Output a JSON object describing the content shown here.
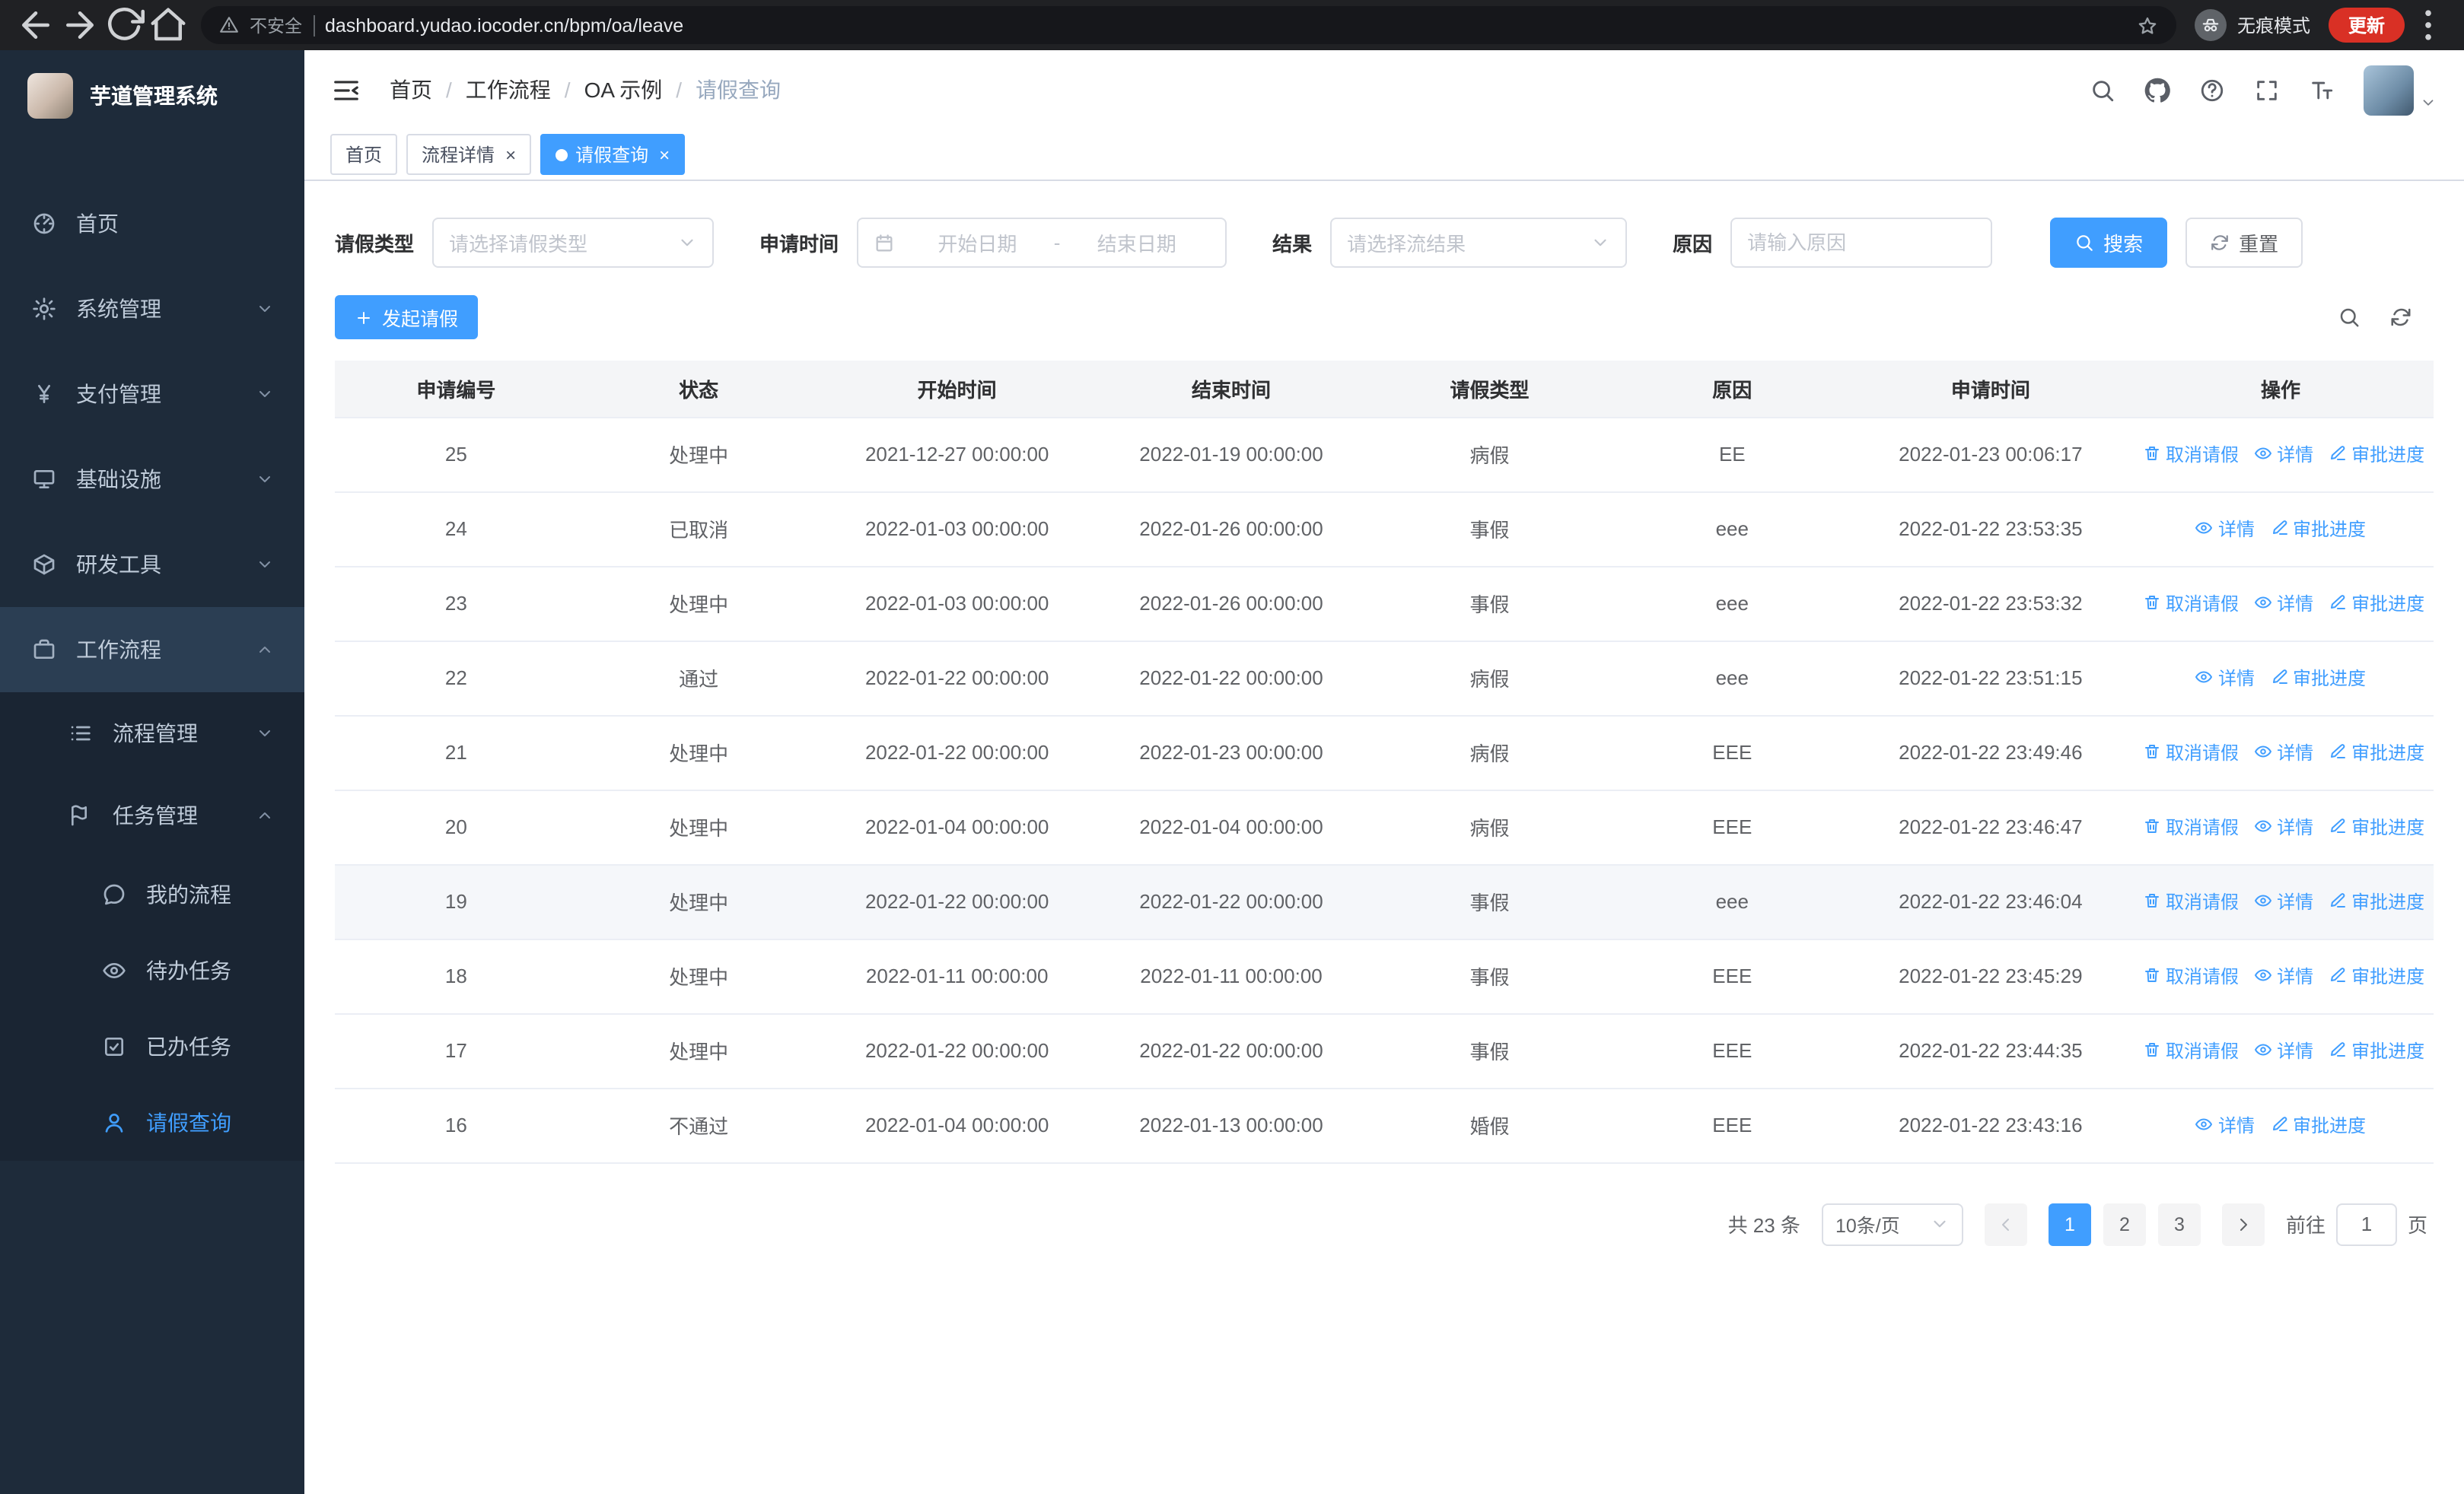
{
  "browser": {
    "security_label": "不安全",
    "url": "dashboard.yudao.iocoder.cn/bpm/oa/leave",
    "incognito_label": "无痕模式",
    "update_label": "更新"
  },
  "colors": {
    "primary": "#409eff",
    "update_button": "#d93025",
    "sidebar_bg": "#1e2b3a"
  },
  "sidebar": {
    "logo_title": "芋道管理系统",
    "items": [
      {
        "name": "home",
        "label": "首页",
        "icon": "dashboard-icon",
        "level": 1
      },
      {
        "name": "system",
        "label": "系统管理",
        "icon": "gear-icon",
        "level": 1,
        "chevron": "down"
      },
      {
        "name": "payment",
        "label": "支付管理",
        "icon": "yen-icon",
        "level": 1,
        "chevron": "down"
      },
      {
        "name": "infrastructure",
        "label": "基础设施",
        "icon": "monitor-icon",
        "level": 1,
        "chevron": "down"
      },
      {
        "name": "dev-tools",
        "label": "研发工具",
        "icon": "toolbox-icon",
        "level": 1,
        "chevron": "down"
      },
      {
        "name": "workflow",
        "label": "工作流程",
        "icon": "briefcase-icon",
        "level": 1,
        "chevron": "up",
        "highlight": true
      },
      {
        "name": "process-mgmt",
        "label": "流程管理",
        "icon": "list-icon",
        "level": 2,
        "chevron": "down"
      },
      {
        "name": "task-mgmt",
        "label": "任务管理",
        "icon": "task-icon",
        "level": 2,
        "chevron": "up"
      },
      {
        "name": "my-process",
        "label": "我的流程",
        "icon": "chat-icon",
        "level": 3
      },
      {
        "name": "todo-tasks",
        "label": "待办任务",
        "icon": "eye-icon",
        "level": 3
      },
      {
        "name": "done-tasks",
        "label": "已办任务",
        "icon": "done-icon",
        "level": 3
      },
      {
        "name": "leave-query",
        "label": "请假查询",
        "icon": "user-icon",
        "level": 3,
        "active": true
      }
    ]
  },
  "header": {
    "breadcrumb_separator": "/",
    "breadcrumb": [
      {
        "label": "首页"
      },
      {
        "label": "工作流程"
      },
      {
        "label": "OA 示例"
      },
      {
        "label": "请假查询",
        "current": true
      }
    ]
  },
  "tabs": [
    {
      "name": "home",
      "label": "首页"
    },
    {
      "name": "process-detail",
      "label": "流程详情",
      "closable": true
    },
    {
      "name": "leave-query",
      "label": "请假查询",
      "closable": true,
      "active": true
    }
  ],
  "filters": {
    "leave_type": {
      "label": "请假类型",
      "placeholder": "请选择请假类型"
    },
    "apply_time": {
      "label": "申请时间",
      "start_placeholder": "开始日期",
      "separator": "-",
      "end_placeholder": "结束日期"
    },
    "result": {
      "label": "结果",
      "placeholder": "请选择流结果"
    },
    "reason": {
      "label": "原因",
      "placeholder": "请输入原因"
    },
    "search_label": "搜索",
    "reset_label": "重置"
  },
  "toolbar": {
    "create_label": "发起请假"
  },
  "table": {
    "columns": [
      "申请编号",
      "状态",
      "开始时间",
      "结束时间",
      "请假类型",
      "原因",
      "申请时间",
      "操作"
    ],
    "action_labels": {
      "cancel": "取消请假",
      "detail": "详情",
      "progress": "审批进度"
    },
    "rows": [
      {
        "id": "25",
        "status": "处理中",
        "start": "2021-12-27 00:00:00",
        "end": "2022-01-19 00:00:00",
        "type": "病假",
        "reason": "EE",
        "applied": "2022-01-23 00:06:17",
        "actions": [
          "cancel",
          "detail",
          "progress"
        ]
      },
      {
        "id": "24",
        "status": "已取消",
        "start": "2022-01-03 00:00:00",
        "end": "2022-01-26 00:00:00",
        "type": "事假",
        "reason": "eee",
        "applied": "2022-01-22 23:53:35",
        "actions": [
          "detail",
          "progress"
        ]
      },
      {
        "id": "23",
        "status": "处理中",
        "start": "2022-01-03 00:00:00",
        "end": "2022-01-26 00:00:00",
        "type": "事假",
        "reason": "eee",
        "applied": "2022-01-22 23:53:32",
        "actions": [
          "cancel",
          "detail",
          "progress"
        ]
      },
      {
        "id": "22",
        "status": "通过",
        "start": "2022-01-22 00:00:00",
        "end": "2022-01-22 00:00:00",
        "type": "病假",
        "reason": "eee",
        "applied": "2022-01-22 23:51:15",
        "actions": [
          "detail",
          "progress"
        ]
      },
      {
        "id": "21",
        "status": "处理中",
        "start": "2022-01-22 00:00:00",
        "end": "2022-01-23 00:00:00",
        "type": "病假",
        "reason": "EEE",
        "applied": "2022-01-22 23:49:46",
        "actions": [
          "cancel",
          "detail",
          "progress"
        ]
      },
      {
        "id": "20",
        "status": "处理中",
        "start": "2022-01-04 00:00:00",
        "end": "2022-01-04 00:00:00",
        "type": "病假",
        "reason": "EEE",
        "applied": "2022-01-22 23:46:47",
        "actions": [
          "cancel",
          "detail",
          "progress"
        ]
      },
      {
        "id": "19",
        "status": "处理中",
        "start": "2022-01-22 00:00:00",
        "end": "2022-01-22 00:00:00",
        "type": "事假",
        "reason": "eee",
        "applied": "2022-01-22 23:46:04",
        "actions": [
          "cancel",
          "detail",
          "progress"
        ],
        "hover": true
      },
      {
        "id": "18",
        "status": "处理中",
        "start": "2022-01-11 00:00:00",
        "end": "2022-01-11 00:00:00",
        "type": "事假",
        "reason": "EEE",
        "applied": "2022-01-22 23:45:29",
        "actions": [
          "cancel",
          "detail",
          "progress"
        ]
      },
      {
        "id": "17",
        "status": "处理中",
        "start": "2022-01-22 00:00:00",
        "end": "2022-01-22 00:00:00",
        "type": "事假",
        "reason": "EEE",
        "applied": "2022-01-22 23:44:35",
        "actions": [
          "cancel",
          "detail",
          "progress"
        ]
      },
      {
        "id": "16",
        "status": "不通过",
        "start": "2022-01-04 00:00:00",
        "end": "2022-01-13 00:00:00",
        "type": "婚假",
        "reason": "EEE",
        "applied": "2022-01-22 23:43:16",
        "actions": [
          "detail",
          "progress"
        ]
      }
    ]
  },
  "pagination": {
    "total_text": "共 23 条",
    "page_size": "10条/页",
    "pages": [
      "1",
      "2",
      "3"
    ],
    "active_page": "1",
    "goto_prefix": "前往",
    "goto_value": "1",
    "goto_suffix": "页"
  }
}
